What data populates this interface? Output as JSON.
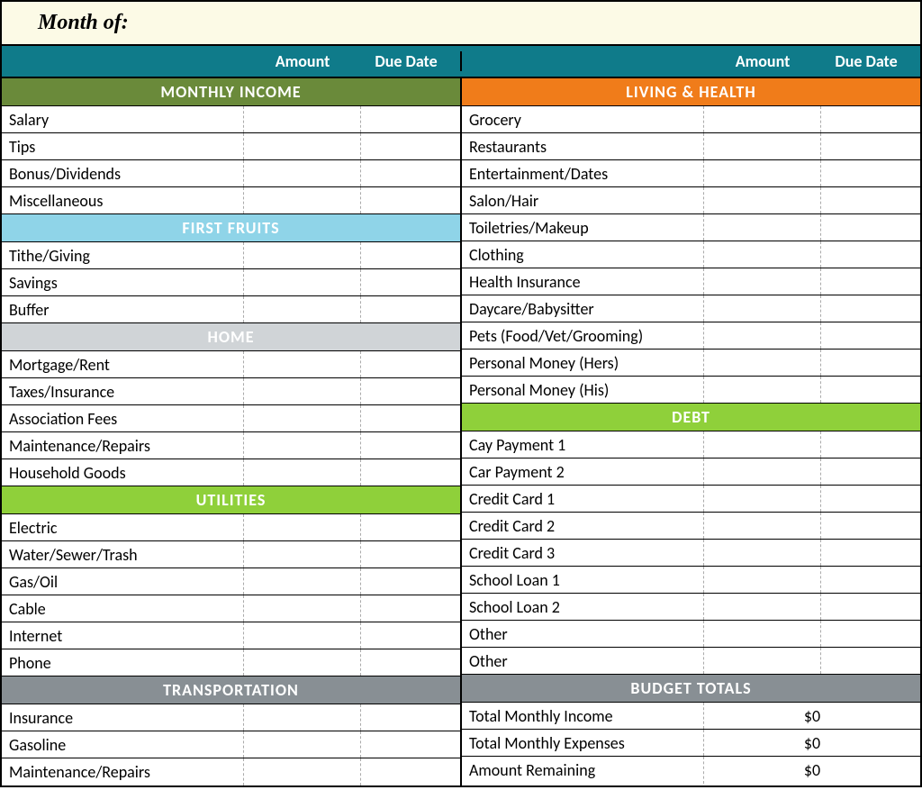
{
  "title": "Month of:",
  "headers": {
    "amount": "Amount",
    "due_date": "Due Date"
  },
  "left_sections": [
    {
      "class": "sec-income",
      "title": "MONTHLY INCOME",
      "rows": [
        {
          "label": "Salary",
          "amount": "",
          "due": ""
        },
        {
          "label": "Tips",
          "amount": "",
          "due": ""
        },
        {
          "label": "Bonus/Dividends",
          "amount": "",
          "due": ""
        },
        {
          "label": "Miscellaneous",
          "amount": "",
          "due": ""
        }
      ]
    },
    {
      "class": "sec-first",
      "title": "FIRST FRUITS",
      "rows": [
        {
          "label": "Tithe/Giving",
          "amount": "",
          "due": ""
        },
        {
          "label": "Savings",
          "amount": "",
          "due": ""
        },
        {
          "label": "Buffer",
          "amount": "",
          "due": ""
        }
      ]
    },
    {
      "class": "sec-home",
      "title": "HOME",
      "rows": [
        {
          "label": "Mortgage/Rent",
          "amount": "",
          "due": ""
        },
        {
          "label": "Taxes/Insurance",
          "amount": "",
          "due": ""
        },
        {
          "label": "Association Fees",
          "amount": "",
          "due": ""
        },
        {
          "label": "Maintenance/Repairs",
          "amount": "",
          "due": ""
        },
        {
          "label": "Household Goods",
          "amount": "",
          "due": ""
        }
      ]
    },
    {
      "class": "sec-util",
      "title": "UTILITIES",
      "rows": [
        {
          "label": "Electric",
          "amount": "",
          "due": ""
        },
        {
          "label": "Water/Sewer/Trash",
          "amount": "",
          "due": ""
        },
        {
          "label": "Gas/Oil",
          "amount": "",
          "due": ""
        },
        {
          "label": "Cable",
          "amount": "",
          "due": ""
        },
        {
          "label": "Internet",
          "amount": "",
          "due": ""
        },
        {
          "label": "Phone",
          "amount": "",
          "due": ""
        }
      ]
    },
    {
      "class": "sec-trans",
      "title": "TRANSPORTATION",
      "rows": [
        {
          "label": "Insurance",
          "amount": "",
          "due": ""
        },
        {
          "label": "Gasoline",
          "amount": "",
          "due": ""
        },
        {
          "label": "Maintenance/Repairs",
          "amount": "",
          "due": ""
        }
      ]
    }
  ],
  "right_sections": [
    {
      "class": "sec-living",
      "title": "LIVING & HEALTH",
      "rows": [
        {
          "label": "Grocery",
          "amount": "",
          "due": ""
        },
        {
          "label": "Restaurants",
          "amount": "",
          "due": ""
        },
        {
          "label": "Entertainment/Dates",
          "amount": "",
          "due": ""
        },
        {
          "label": "Salon/Hair",
          "amount": "",
          "due": ""
        },
        {
          "label": "Toiletries/Makeup",
          "amount": "",
          "due": ""
        },
        {
          "label": "Clothing",
          "amount": "",
          "due": ""
        },
        {
          "label": "Health Insurance",
          "amount": "",
          "due": ""
        },
        {
          "label": "Daycare/Babysitter",
          "amount": "",
          "due": ""
        },
        {
          "label": "Pets (Food/Vet/Grooming)",
          "amount": "",
          "due": ""
        },
        {
          "label": "Personal Money (Hers)",
          "amount": "",
          "due": ""
        },
        {
          "label": "Personal Money (His)",
          "amount": "",
          "due": ""
        }
      ]
    },
    {
      "class": "sec-debt",
      "title": "DEBT",
      "rows": [
        {
          "label": "Cay Payment 1",
          "amount": "",
          "due": ""
        },
        {
          "label": "Car Payment 2",
          "amount": "",
          "due": ""
        },
        {
          "label": "Credit Card 1",
          "amount": "",
          "due": ""
        },
        {
          "label": "Credit Card 2",
          "amount": "",
          "due": ""
        },
        {
          "label": "Credit Card 3",
          "amount": "",
          "due": ""
        },
        {
          "label": "School Loan 1",
          "amount": "",
          "due": ""
        },
        {
          "label": "School Loan 2",
          "amount": "",
          "due": ""
        },
        {
          "label": "Other",
          "amount": "",
          "due": ""
        },
        {
          "label": "Other",
          "amount": "",
          "due": ""
        }
      ]
    },
    {
      "class": "sec-totals",
      "title": "BUDGET TOTALS",
      "totals": [
        {
          "label": "Total Monthly Income",
          "value": "$0"
        },
        {
          "label": "Total Monthly Expenses",
          "value": "$0"
        },
        {
          "label": "Amount Remaining",
          "value": "$0"
        }
      ]
    }
  ]
}
